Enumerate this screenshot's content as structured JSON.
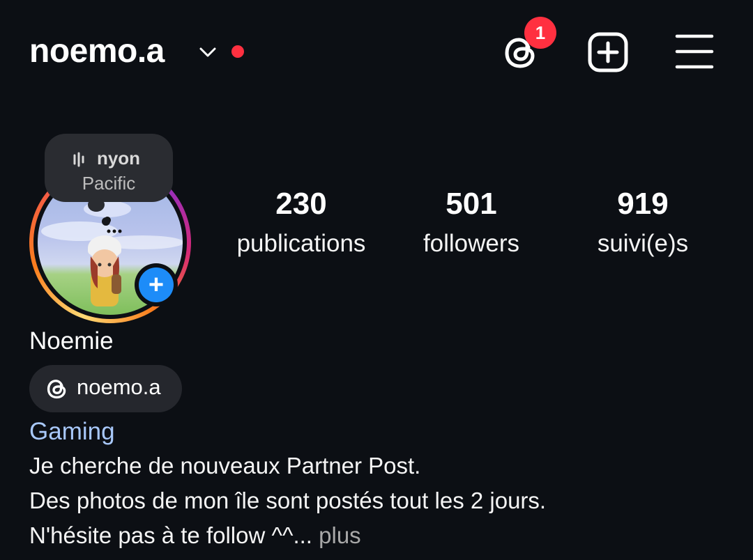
{
  "header": {
    "username": "noemo.a",
    "threads_badge_count": "1",
    "icons": {
      "switch": "chevron-down-icon",
      "threads": "threads-icon",
      "create": "add-square-icon",
      "menu": "hamburger-menu-icon"
    }
  },
  "note": {
    "line1": "nyon",
    "line2": "Pacific",
    "icon": "music-bars-icon"
  },
  "stats": {
    "publications": {
      "value": "230",
      "label": "publications"
    },
    "followers": {
      "value": "501",
      "label": "followers"
    },
    "following": {
      "value": "919",
      "label": "suivi(e)s"
    }
  },
  "profile": {
    "display_name": "Noemie",
    "threads_handle": "noemo.a",
    "category": "Gaming",
    "bio_lines": [
      "Je cherche de nouveaux Partner Post.",
      "Des photos de mon île sont postés tout les 2 jours.",
      "N'hésite pas à te follow ^^"
    ],
    "bio_ellipsis": "...",
    "bio_more": " plus"
  },
  "colors": {
    "background": "#0c0f14",
    "badge_red": "#ff3040",
    "add_story_blue": "#1d8cf8",
    "category_link": "#a8c8fa"
  }
}
